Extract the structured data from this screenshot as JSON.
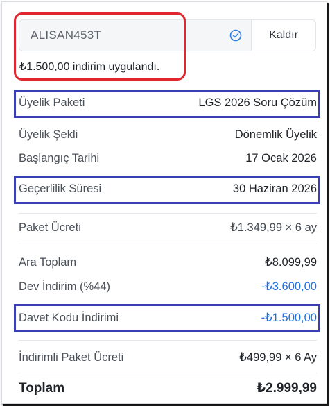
{
  "coupon": {
    "code": "ALISAN453T",
    "remove_label": "Kaldır",
    "applied_message": "₺1.500,00 indirim uygulandı."
  },
  "summary": {
    "package": {
      "label": "Üyelik Paketi",
      "value": "LGS 2026 Soru Çözüm"
    },
    "membership_type": {
      "label": "Üyelik Şekli",
      "value": "Dönemlik Üyelik"
    },
    "start_date": {
      "label": "Başlangıç Tarihi",
      "value": "17 Ocak 2026"
    },
    "validity": {
      "label": "Geçerlilik Süresi",
      "value": "30 Haziran 2026"
    },
    "package_price": {
      "label": "Paket Ücreti",
      "value": "₺1.349,99 × 6 ay"
    },
    "subtotal": {
      "label": "Ara Toplam",
      "value": "₺8.099,99"
    },
    "big_discount": {
      "label": "Dev İndirim (%44)",
      "value": "-₺3.600,00"
    },
    "invite_discount": {
      "label": "Davet Kodu İndirimi",
      "value": "-₺1.500,00"
    },
    "discounted_price": {
      "label": "İndirimli Paket Ücreti",
      "value": "₺499,99 × 6 Ay"
    },
    "total": {
      "label": "Toplam",
      "value": "₺2.999,99"
    }
  },
  "colors": {
    "highlight_red": "#e0262f",
    "highlight_blue": "#3b3fb5",
    "discount_blue": "#1f6fe0"
  },
  "icons": {
    "coupon_check": "check-circle-icon"
  }
}
